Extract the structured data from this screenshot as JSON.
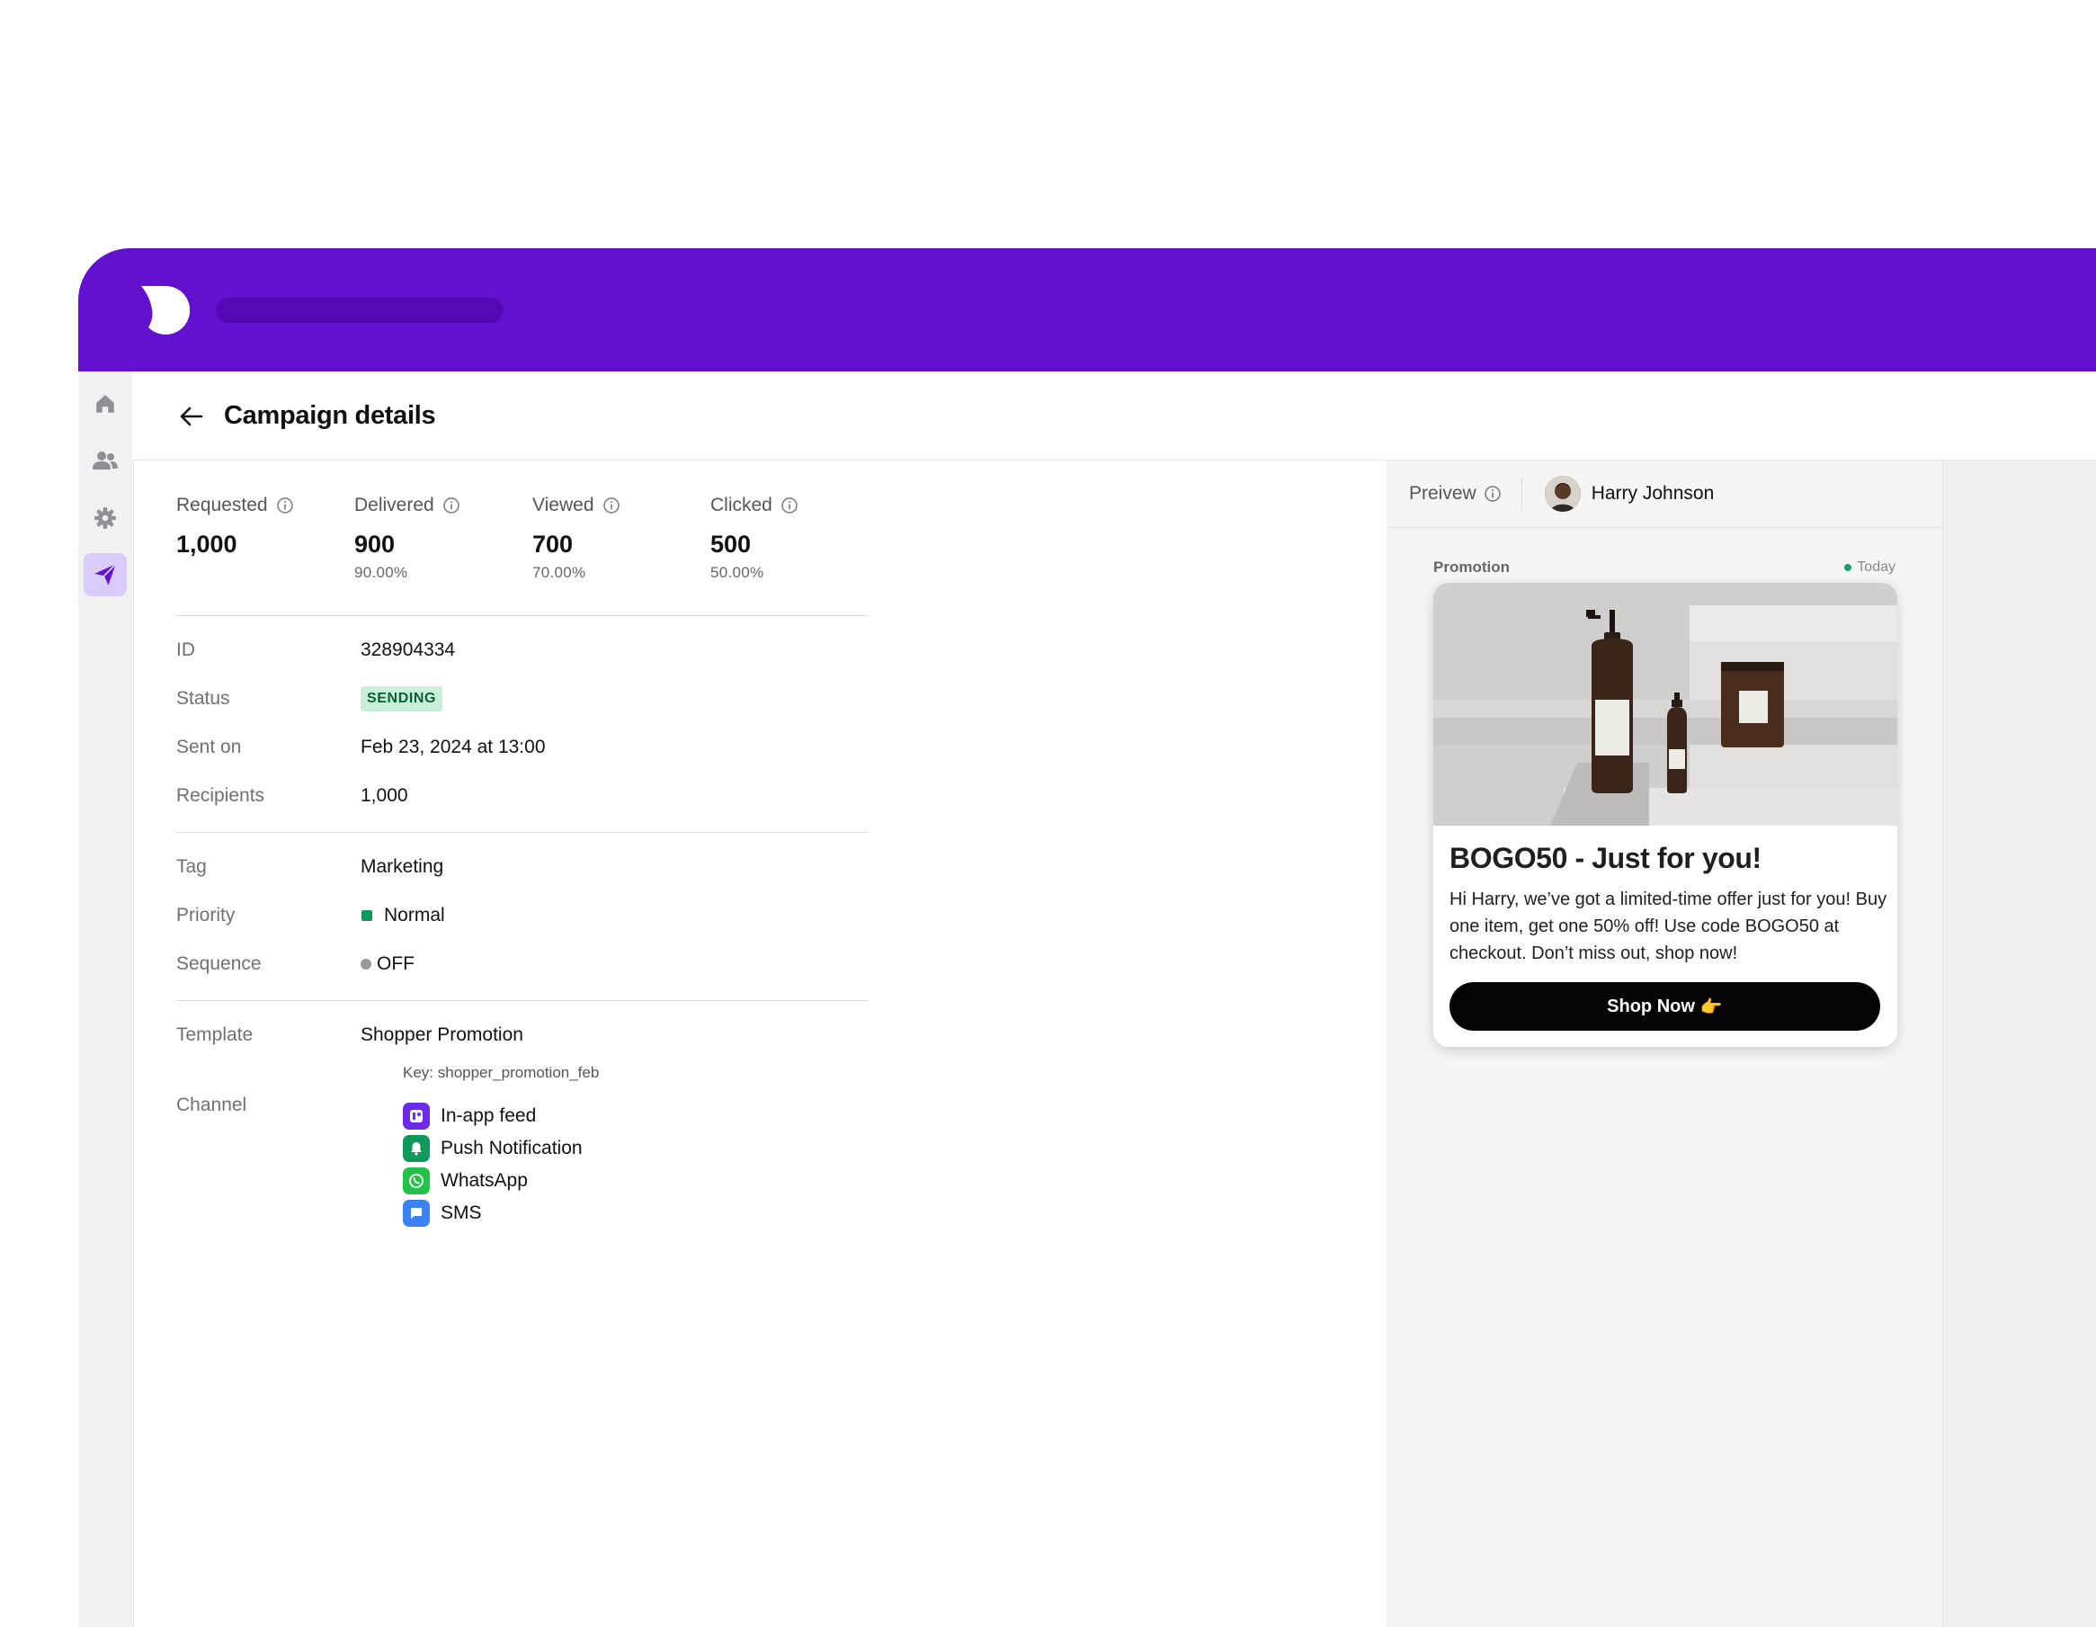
{
  "header": {
    "title": "Campaign details"
  },
  "stats": [
    {
      "label": "Requested",
      "value": "1,000",
      "pct": ""
    },
    {
      "label": "Delivered",
      "value": "900",
      "pct": "90.00%"
    },
    {
      "label": "Viewed",
      "value": "700",
      "pct": "70.00%"
    },
    {
      "label": "Clicked",
      "value": "500",
      "pct": "50.00%"
    }
  ],
  "details": {
    "id": {
      "label": "ID",
      "value": "328904334"
    },
    "status": {
      "label": "Status",
      "value": "SENDING"
    },
    "sent_on": {
      "label": "Sent on",
      "value": "Feb 23, 2024 at 13:00"
    },
    "recipients": {
      "label": "Recipients",
      "value": "1,000"
    },
    "tag": {
      "label": "Tag",
      "value": "Marketing"
    },
    "priority": {
      "label": "Priority",
      "value": "Normal"
    },
    "sequence": {
      "label": "Sequence",
      "value": "OFF"
    },
    "template": {
      "label": "Template",
      "value": "Shopper Promotion",
      "key": "Key: shopper_promotion_feb"
    },
    "channel": {
      "label": "Channel",
      "items": [
        "In-app feed",
        "Push Notification",
        "WhatsApp",
        "SMS"
      ]
    }
  },
  "preview": {
    "label": "Preivew",
    "user": "Harry Johnson",
    "message": {
      "category": "Promotion",
      "time": "Today",
      "title": "BOGO50 - Just for you!",
      "body": "Hi Harry, we’ve got a limited-time offer just for you! Buy one item, get one 50% off! Use code BOGO50 at checkout. Don’t miss out, shop now!",
      "cta": "Shop Now",
      "cta_emoji": "👉"
    }
  },
  "colors": {
    "brand": "#6311cf",
    "status_badge_bg": "#c8efd9",
    "priority_normal": "#0f9a5c",
    "channel_inapp": "#6d2ae8",
    "channel_push": "#0f9a5c",
    "channel_whatsapp": "#25c24a",
    "channel_sms": "#3b82f6"
  },
  "icons": {
    "sidebar": [
      "home-icon",
      "users-icon",
      "settings-icon",
      "send-icon"
    ],
    "back": "arrow-left-icon",
    "info": "info-icon"
  }
}
